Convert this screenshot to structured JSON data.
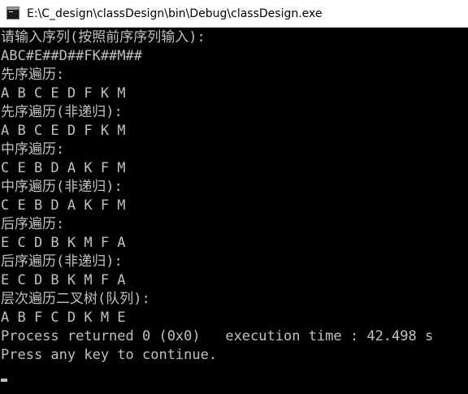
{
  "window": {
    "title": "E:\\C_design\\classDesign\\bin\\Debug\\classDesign.exe",
    "icon": "console-app-icon"
  },
  "console": {
    "lines": [
      "请输入序列(按照前序序列输入):",
      "ABC#E##D##FK##M##",
      "先序遍历:",
      "A B C E D F K M",
      "先序遍历(非递归):",
      "A B C E D F K M",
      "中序遍历:",
      "C E B D A K F M",
      "中序遍历(非递归):",
      "C E B D A K F M",
      "后序遍历:",
      "E C D B K M F A",
      "后序遍历(非递归):",
      "E C D B K M F A",
      "层次遍历二叉树(队列):",
      "A B F C D K M E",
      "Process returned 0 (0x0)   execution time : 42.498 s",
      "Press any key to continue."
    ],
    "text_color": "#c0c0c0",
    "background_color": "#000000"
  }
}
